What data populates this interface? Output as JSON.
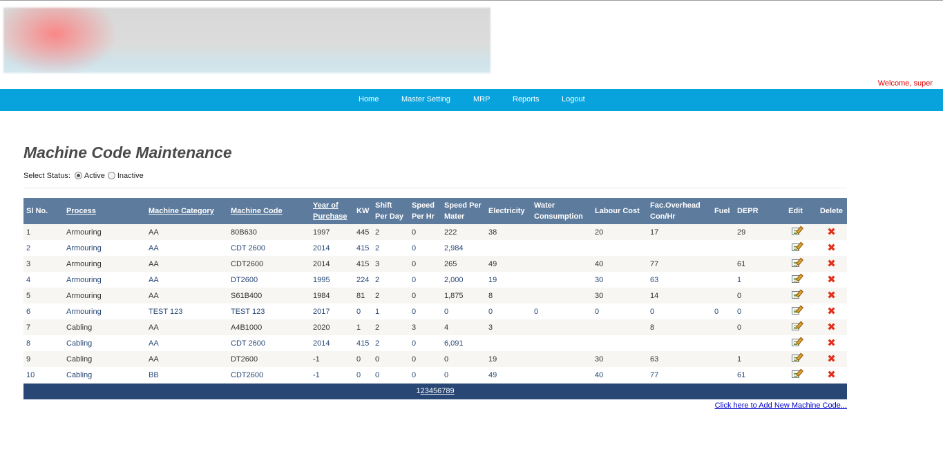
{
  "header": {
    "welcome_text": "Welcome, super"
  },
  "nav": {
    "items": [
      "Home",
      "Master Setting",
      "MRP",
      "Reports",
      "Logout"
    ]
  },
  "page": {
    "title": "Machine Code Maintenance",
    "status_label": "Select Status:",
    "status_options": [
      "Active",
      "Inactive"
    ],
    "status_selected": "Active"
  },
  "table": {
    "headers": [
      "Sl No.",
      "Process",
      "Machine Category",
      "Machine Code",
      "Year of Purchase",
      "KW",
      "Shift Per Day",
      "Speed Per Hr",
      "Speed Per Mater",
      "Electricity",
      "Water Consumption",
      "Labour Cost",
      "Fac.Overhead Con/Hr",
      "Fuel",
      "DEPR",
      "Edit",
      "Delete"
    ],
    "rows": [
      [
        "1",
        "Armouring",
        "AA",
        "80B630",
        "1997",
        "445",
        "2",
        "0",
        "222",
        "38",
        "",
        "20",
        "17",
        "",
        "29"
      ],
      [
        "2",
        "Armouring",
        "AA",
        "CDT 2600",
        "2014",
        "415",
        "2",
        "0",
        "2,984",
        "",
        "",
        "",
        "",
        "",
        ""
      ],
      [
        "3",
        "Armouring",
        "AA",
        "CDT2600",
        "2014",
        "415",
        "3",
        "0",
        "265",
        "49",
        "",
        "40",
        "77",
        "",
        "61"
      ],
      [
        "4",
        "Armouring",
        "AA",
        "DT2600",
        "1995",
        "224",
        "2",
        "0",
        "2,000",
        "19",
        "",
        "30",
        "63",
        "",
        "1"
      ],
      [
        "5",
        "Armouring",
        "AA",
        "S61B400",
        "1984",
        "81",
        "2",
        "0",
        "1,875",
        "8",
        "",
        "30",
        "14",
        "",
        "0"
      ],
      [
        "6",
        "Armouring",
        "TEST 123",
        "TEST 123",
        "2017",
        "0",
        "1",
        "0",
        "0",
        "0",
        "0",
        "0",
        "0",
        "0",
        "0"
      ],
      [
        "7",
        "Cabling",
        "AA",
        "A4B1000",
        "2020",
        "1",
        "2",
        "3",
        "4",
        "3",
        "",
        "",
        "8",
        "",
        "0"
      ],
      [
        "8",
        "Cabling",
        "AA",
        "CDT 2600",
        "2014",
        "415",
        "2",
        "0",
        "6,091",
        "",
        "",
        "",
        "",
        "",
        ""
      ],
      [
        "9",
        "Cabling",
        "AA",
        "DT2600",
        "-1",
        "0",
        "0",
        "0",
        "0",
        "19",
        "",
        "30",
        "63",
        "",
        "1"
      ],
      [
        "10",
        "Cabling",
        "BB",
        "CDT2600",
        "-1",
        "0",
        "0",
        "0",
        "0",
        "49",
        "",
        "40",
        "77",
        "",
        "61"
      ]
    ]
  },
  "pager": {
    "current": "1",
    "pages": [
      "2",
      "3",
      "4",
      "5",
      "6",
      "7",
      "8",
      "9"
    ]
  },
  "footer": {
    "add_link": "Click here to Add New Machine Code..."
  },
  "icons": {
    "edit": "edit-icon",
    "delete": "delete-icon"
  },
  "colors": {
    "nav_bar": "#08a3dc",
    "header_row": "#5d7b9d",
    "pager_bar": "#284775",
    "welcome": "#e00000"
  }
}
